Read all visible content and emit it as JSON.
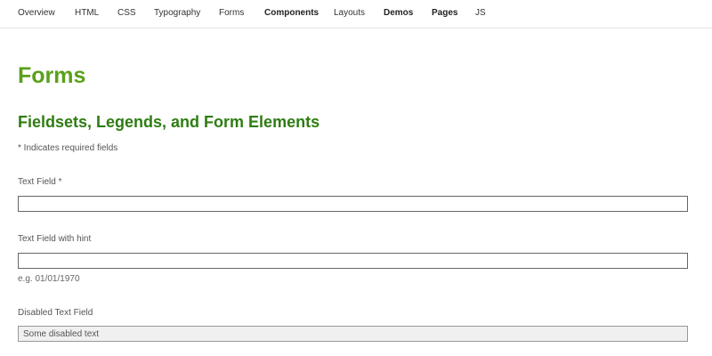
{
  "nav": {
    "items": [
      {
        "label": "Overview",
        "bold": false
      },
      {
        "label": "HTML",
        "bold": false
      },
      {
        "label": "CSS",
        "bold": false
      },
      {
        "label": "Typography",
        "bold": false
      },
      {
        "label": "Forms",
        "bold": false
      },
      {
        "label": "Components",
        "bold": true
      },
      {
        "label": "Layouts",
        "bold": false
      },
      {
        "label": "Demos",
        "bold": true
      },
      {
        "label": "Pages",
        "bold": true
      },
      {
        "label": "JS",
        "bold": false
      }
    ]
  },
  "page": {
    "title": "Forms",
    "section_title": "Fieldsets, Legends, and Form Elements",
    "required_note": "* Indicates required fields"
  },
  "fields": {
    "text_field": {
      "label": "Text Field *",
      "value": ""
    },
    "hint_field": {
      "label": "Text Field with hint",
      "value": "",
      "hint": "e.g. 01/01/1970"
    },
    "disabled_field": {
      "label": "Disabled Text Field",
      "value": "Some disabled text"
    }
  },
  "colors": {
    "page_title": "#5aa01a",
    "section_title": "#2e7d12"
  }
}
